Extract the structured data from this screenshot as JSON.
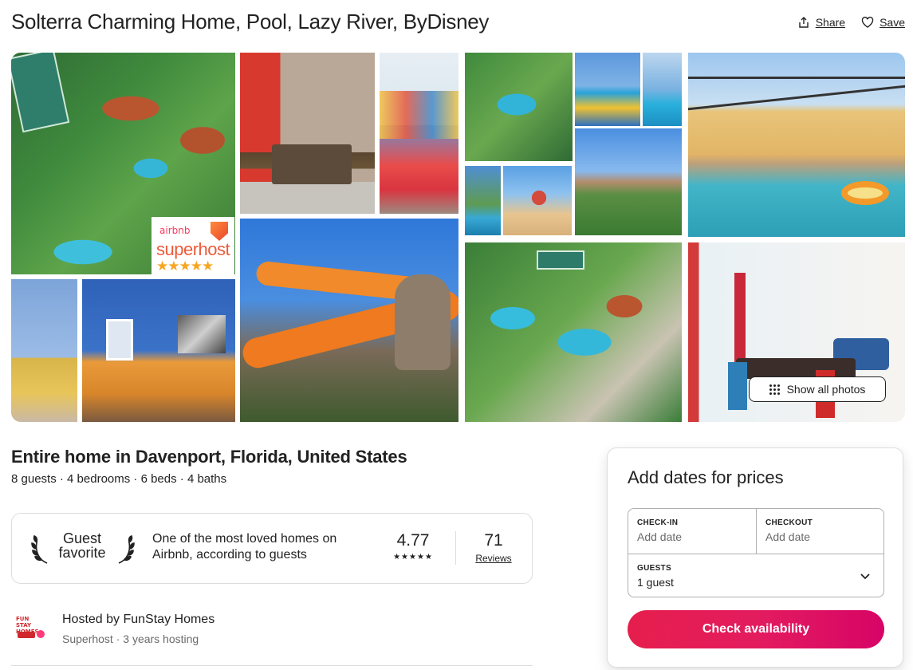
{
  "listing": {
    "title": "Solterra Charming Home, Pool, Lazy River, ByDisney",
    "share_label": "Share",
    "save_label": "Save",
    "show_all_photos_label": "Show all photos",
    "badge": {
      "brand": "airbnb",
      "text": "superhost",
      "stars": "★★★★★"
    }
  },
  "summary": {
    "subtitle": "Entire home in Davenport, Florida, United States",
    "details": "8 guests · 4 bedrooms · 6 beds · 4 baths"
  },
  "guest_favorite": {
    "title_line1": "Guest",
    "title_line2": "favorite",
    "description": "One of the most loved homes on Airbnb, according to guests",
    "rating": "4.77",
    "rating_stars": "★★★★★",
    "reviews_count": "71",
    "reviews_label": "Reviews"
  },
  "host": {
    "name": "Hosted by FunStay Homes",
    "sub": "Superhost · 3 years hosting",
    "logo_text": "FUN STAY HOMES"
  },
  "booking": {
    "title": "Add dates for prices",
    "checkin_label": "CHECK-IN",
    "checkin_placeholder": "Add date",
    "checkout_label": "CHECKOUT",
    "checkout_placeholder": "Add date",
    "guests_label": "GUESTS",
    "guests_value": "1 guest",
    "cta_label": "Check availability"
  },
  "colors": {
    "brand": "#ff385c",
    "cta_start": "#e61e4d",
    "cta_end": "#d70466",
    "text": "#222222",
    "muted": "#6a6a6a",
    "border": "#dddddd"
  },
  "icons": [
    "share-icon",
    "heart-icon",
    "grid-dots-icon",
    "laurel-left-icon",
    "laurel-right-icon",
    "chevron-down-icon"
  ]
}
